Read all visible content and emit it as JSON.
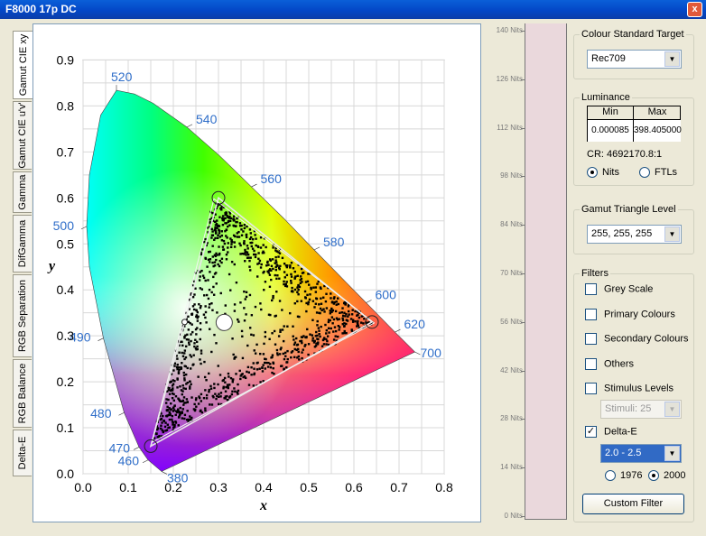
{
  "window": {
    "title": "F8000 17p DC",
    "close_glyph": "x"
  },
  "tabs": [
    "Gamut CIE xy",
    "Gamut CIE u'v'",
    "Gamma",
    "DifGamma",
    "RGB Separation",
    "RGB Balance",
    "Delta-E"
  ],
  "chart_data": {
    "type": "scatter",
    "xlabel": "x",
    "ylabel": "y",
    "xlim": [
      0,
      0.8
    ],
    "ylim": [
      0,
      0.9
    ],
    "x_ticks": [
      "0.0",
      "0.1",
      "0.2",
      "0.3",
      "0.4",
      "0.5",
      "0.6",
      "0.7",
      "0.8"
    ],
    "y_ticks": [
      "0.0",
      "0.1",
      "0.2",
      "0.3",
      "0.4",
      "0.5",
      "0.6",
      "0.7",
      "0.8",
      "0.9"
    ],
    "grid": true,
    "wavelength_labels": [
      {
        "nm": "380",
        "x": 0.174,
        "y": 0.005
      },
      {
        "nm": "460",
        "x": 0.144,
        "y": 0.03
      },
      {
        "nm": "470",
        "x": 0.124,
        "y": 0.058
      },
      {
        "nm": "480",
        "x": 0.091,
        "y": 0.133
      },
      {
        "nm": "490",
        "x": 0.045,
        "y": 0.295
      },
      {
        "nm": "500",
        "x": 0.008,
        "y": 0.538
      },
      {
        "nm": "520",
        "x": 0.074,
        "y": 0.834
      },
      {
        "nm": "540",
        "x": 0.23,
        "y": 0.754
      },
      {
        "nm": "560",
        "x": 0.373,
        "y": 0.624
      },
      {
        "nm": "580",
        "x": 0.512,
        "y": 0.487
      },
      {
        "nm": "600",
        "x": 0.627,
        "y": 0.372
      },
      {
        "nm": "620",
        "x": 0.691,
        "y": 0.308
      },
      {
        "nm": "700",
        "x": 0.735,
        "y": 0.265
      }
    ],
    "target": {
      "red": [
        0.64,
        0.33
      ],
      "green": [
        0.3,
        0.6
      ],
      "blue": [
        0.15,
        0.06
      ],
      "white": [
        0.3127,
        0.329
      ]
    },
    "measured": {
      "red": [
        0.645,
        0.328
      ],
      "green": [
        0.29,
        0.598
      ],
      "blue": [
        0.152,
        0.068
      ],
      "white": [
        0.225,
        0.33
      ]
    }
  },
  "nits_axis": [
    "140 Nits",
    "126 Nits",
    "112 Nits",
    "98 Nits",
    "84 Nits",
    "70 Nits",
    "56 Nits",
    "42 Nits",
    "28 Nits",
    "14 Nits",
    "0 Nits"
  ],
  "colour_target": {
    "title": "Colour Standard Target",
    "value": "Rec709"
  },
  "luminance": {
    "title": "Luminance",
    "min_label": "Min",
    "max_label": "Max",
    "min": "0.000085",
    "max": "398.405000",
    "cr": "CR: 4692170.8:1",
    "nits": "Nits",
    "ftls": "FTLs",
    "selected": "Nits"
  },
  "gamut_level": {
    "title": "Gamut Triangle Level",
    "value": "255, 255, 255"
  },
  "filters": {
    "title": "Filters",
    "grey": "Grey Scale",
    "primary": "Primary Colours",
    "secondary": "Secondary Colours",
    "others": "Others",
    "stimulus": "Stimulus Levels",
    "stimuli_value": "Stimuli: 25",
    "deltae": "Delta-E",
    "deltae_checked": true,
    "deltae_range": "2.0 - 2.5",
    "y1976": "1976",
    "y2000": "2000",
    "year_selected": "2000",
    "custom": "Custom Filter"
  },
  "colors": {
    "accent_blue": "#1a5fc8",
    "label_blue": "#2f6ec9"
  }
}
